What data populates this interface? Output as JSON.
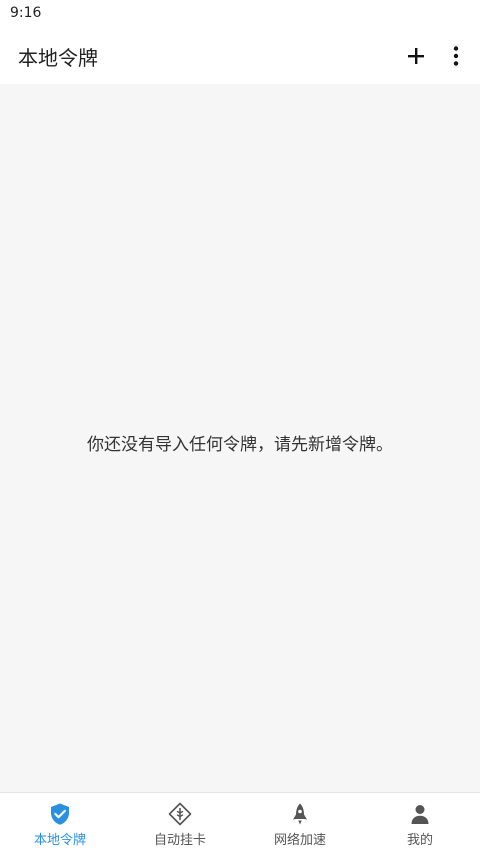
{
  "status_bar": {
    "time": "9:16"
  },
  "app_bar": {
    "title": "本地令牌",
    "add_icon": "plus-icon",
    "more_icon": "more-vertical-icon"
  },
  "main": {
    "empty_message": "你还没有导入任何令牌，请先新增令牌。"
  },
  "bottom_nav": {
    "items": [
      {
        "label": "本地令牌",
        "icon": "shield-check-icon",
        "active": true
      },
      {
        "label": "自动挂卡",
        "icon": "diamond-card-icon",
        "active": false
      },
      {
        "label": "网络加速",
        "icon": "rocket-icon",
        "active": false
      },
      {
        "label": "我的",
        "icon": "person-icon",
        "active": false
      }
    ]
  },
  "colors": {
    "accent": "#2b8fe0",
    "background": "#f6f6f6",
    "icon_inactive": "#555555"
  }
}
